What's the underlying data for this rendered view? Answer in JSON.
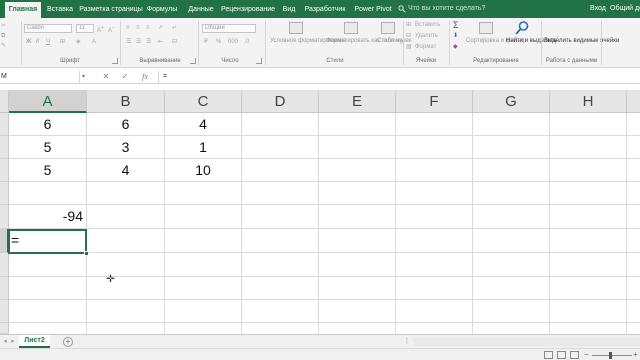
{
  "ribbon_tabs": [
    "Главная",
    "Вставка",
    "Разметка страницы",
    "Формулы",
    "Данные",
    "Рецензирование",
    "Вид",
    "Разработчик",
    "Power Pivot"
  ],
  "active_tab": "Главная",
  "tell_me": "Что вы хотите сделать?",
  "sign_in": "Вход",
  "share": "Общий доступ",
  "ribbon": {
    "font_name": "Calibri",
    "font_size": "11",
    "number_format": "Общий",
    "conditional_formatting": "Условное форматирование",
    "format_as_table": "Форматировать как таблицу",
    "cell_styles": "Стили ячеек",
    "insert": "Вставить",
    "delete": "Удалить",
    "format": "Формат",
    "sort_filter": "Сортировка и фильтр",
    "find_select": "Найти и выделить",
    "select_visible": "Выделить видимые ячейки",
    "groups": {
      "font": "Шрифт",
      "alignment": "Выравнивание",
      "number": "Число",
      "styles": "Стили",
      "cells": "Ячейки",
      "editing": "Редактирование",
      "data_work": "Работа с данными"
    }
  },
  "formula_bar": {
    "name_box": "М",
    "cancel_glyph": "✕",
    "enter_glyph": "✓",
    "fx_glyph": "fx",
    "content": "="
  },
  "columns": [
    "A",
    "B",
    "C",
    "D",
    "E",
    "F",
    "G",
    "H"
  ],
  "active_column": "A",
  "cells": {
    "A1": "6",
    "B1": "6",
    "C1": "4",
    "A2": "5",
    "B2": "3",
    "C2": "1",
    "A3": "5",
    "B3": "4",
    "C3": "10",
    "A5": "-94",
    "A6": "="
  },
  "sheet_tabs": [
    "Лист2"
  ],
  "active_sheet": "Лист2",
  "add_sheet_glyph": "+",
  "cursor_glyph": "✛",
  "icons": {
    "search": "magnifier-icon",
    "add_sheet": "plus-circle-icon",
    "cursor": "crosshair-cursor-icon"
  },
  "colors": {
    "excel_green": "#217346",
    "ribbon_bg": "#f3f3f3",
    "header_bg": "#e6e6e6",
    "gridline": "#dadada"
  }
}
